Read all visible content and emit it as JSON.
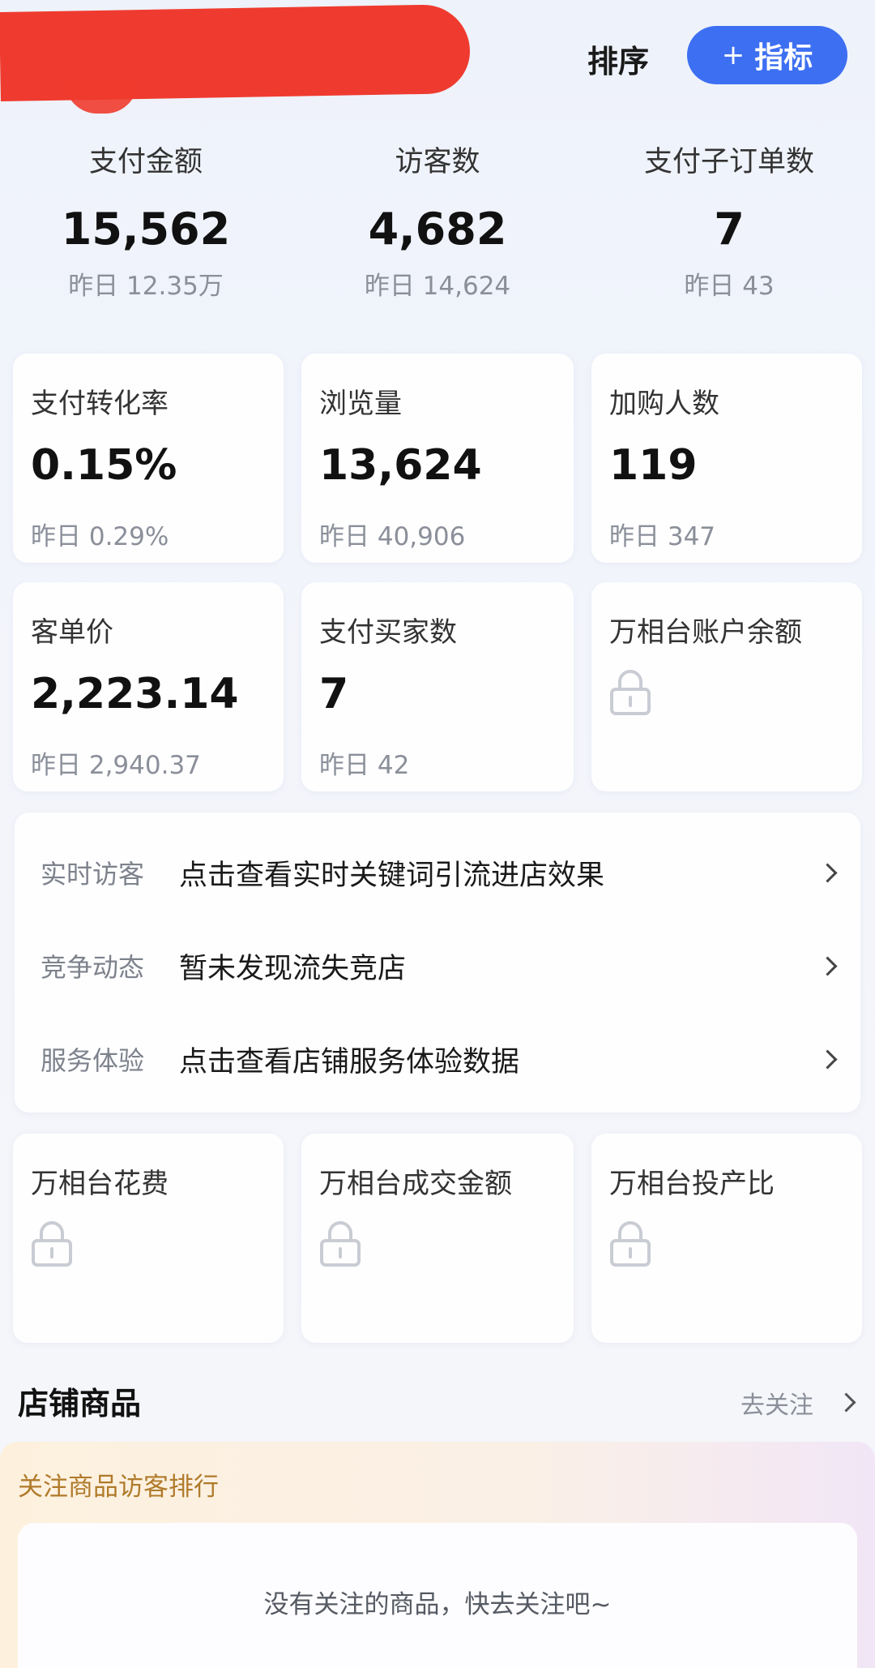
{
  "header": {
    "sort_label": "排序",
    "add_metric_label": "指标",
    "add_metric_icon": "plus-icon"
  },
  "top_stats": [
    {
      "label": "支付金额",
      "value": "15,562",
      "prev": "昨日 12.35万"
    },
    {
      "label": "访客数",
      "value": "4,682",
      "prev": "昨日 14,624"
    },
    {
      "label": "支付子订单数",
      "value": "7",
      "prev": "昨日 43"
    }
  ],
  "cards": {
    "conversion_rate": {
      "label": "支付转化率",
      "value": "0.15%",
      "prev": "昨日 0.29%"
    },
    "page_views": {
      "label": "浏览量",
      "value": "13,624",
      "prev": "昨日 40,906"
    },
    "cart_users": {
      "label": "加购人数",
      "value": "119",
      "prev": "昨日 347"
    },
    "avg_order_value": {
      "label": "客单价",
      "value": "2,223.14",
      "prev": "昨日 2,940.37"
    },
    "paying_buyers": {
      "label": "支付买家数",
      "value": "7",
      "prev": "昨日 42"
    },
    "wxt_balance": {
      "label": "万相台账户余额",
      "icon": "lock-icon"
    },
    "wxt_spend": {
      "label": "万相台花费",
      "icon": "lock-icon"
    },
    "wxt_gmv": {
      "label": "万相台成交金额",
      "icon": "lock-icon"
    },
    "wxt_roi": {
      "label": "万相台投产比",
      "icon": "lock-icon"
    }
  },
  "info_rows": [
    {
      "label": "实时访客",
      "text": "点击查看实时关键词引流进店效果"
    },
    {
      "label": "竞争动态",
      "text": "暂未发现流失竞店"
    },
    {
      "label": "服务体验",
      "text": "点击查看店铺服务体验数据"
    }
  ],
  "store_products": {
    "title": "店铺商品",
    "follow_link": "去关注",
    "ranking_title": "关注商品访客排行",
    "empty_text": "没有关注的商品，快去关注吧~"
  },
  "colors": {
    "accent": "#3d6ff2",
    "redaction": "#ef3b2f",
    "muted_text": "#8a8f99",
    "ranking_title": "#b07a2a"
  }
}
